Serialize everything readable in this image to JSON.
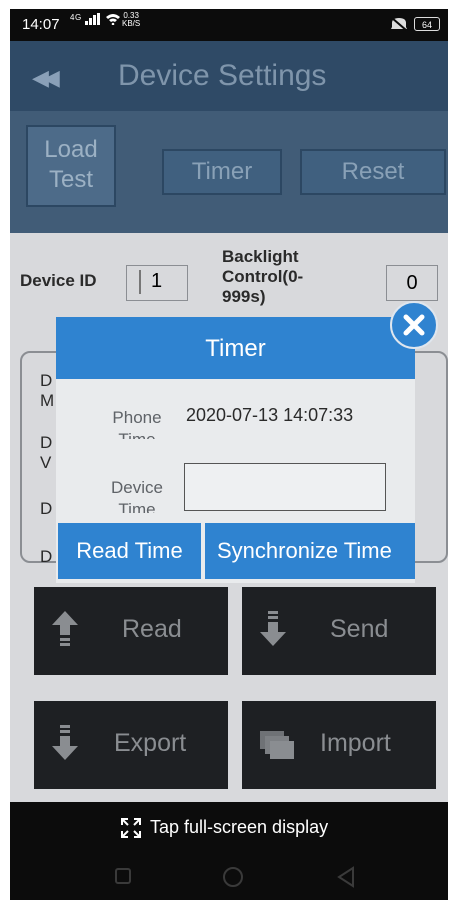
{
  "status_bar": {
    "time": "14:07",
    "network": "4G",
    "speed": "0.33\nKB/S",
    "battery": "64"
  },
  "header": {
    "title": "Device Settings"
  },
  "tabs": [
    {
      "label": "Load\nTest"
    },
    {
      "label": "Timer"
    },
    {
      "label": "Reset"
    }
  ],
  "device_id": {
    "label": "Device ID",
    "value": "1"
  },
  "backlight": {
    "label": "Backlight Control(0-999s)",
    "value": "0"
  },
  "panel_labels": [
    "D\nM",
    "D\nV",
    "D",
    "D"
  ],
  "buttons": {
    "read": "Read",
    "send": "Send",
    "export": "Export",
    "import": "Import"
  },
  "fullscreen": {
    "label": "Tap full-screen display"
  },
  "dialog": {
    "title": "Timer",
    "phone_time_label": "Phone\nTime",
    "phone_time_value": "2020-07-13 14:07:33",
    "device_time_label": "Device\nTime",
    "device_time_value": "",
    "read_time_button": "Read Time",
    "synchronize_time_button": "Synchronize Time"
  },
  "colors": {
    "accent": "#2f83d0",
    "overlay_header": "#2f4a66",
    "dark_button": "#1e2023"
  }
}
